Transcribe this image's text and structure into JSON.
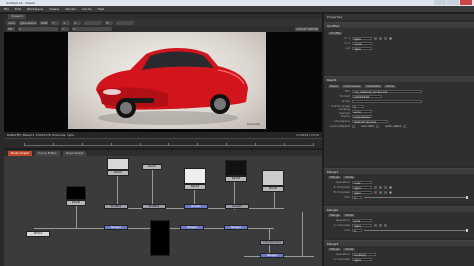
{
  "window": {
    "title": "Untitled.nk - NukeX"
  },
  "menubar": {
    "items": [
      "File",
      "Edit",
      "Workspace",
      "Viewer",
      "Render",
      "Cache",
      "Help"
    ]
  },
  "viewer": {
    "tabs": [
      "Viewer1"
    ],
    "controls_row1": [
      "rgba",
      "rgba.alpha",
      "RGB",
      "Y",
      "1",
      "A",
      "-",
      "B",
      "-"
    ],
    "controls_row2": [
      "f/8",
      "1",
      "Y",
      "1",
      "default (sRGB)"
    ],
    "photo_caption": "(picture)",
    "status_left": "RGBA(FP) 3Read:1 1024x576 channels: rgba",
    "status_right": "x=1024 y=576"
  },
  "nodegraph": {
    "tabs": [
      "Node Graph",
      "Curve Editor",
      "Dope Sheet"
    ],
    "active_tab": "Node Graph",
    "nodes": {
      "read1": "Read1",
      "read2": "Read2",
      "read3": "Read3",
      "read4": "Read4",
      "read5": "Read5",
      "read6": "Read6",
      "merge1": "Merge1",
      "merge2": "Merge2",
      "merge3": "Merge3",
      "merge4": "Merge4",
      "shuffle1": "Shuffle1",
      "shuffle2": "Shuffle2",
      "grade1": "Grade1",
      "grade2": "Grade2",
      "write1": "Write1",
      "dot": "ColorCorrect1"
    }
  },
  "properties": {
    "header": "Properties",
    "panels": [
      {
        "name": "Shuffle1",
        "tab": "Shuffle",
        "rows": [
          {
            "label": "in 1",
            "value": "rgba"
          },
          {
            "label": "in 2",
            "value": "none"
          },
          {
            "label": "out",
            "value": "rgba"
          }
        ]
      },
      {
        "name": "Read1",
        "tabs": [
          "Read",
          "Colorspace",
          "Metadata",
          "Node"
        ],
        "rows": [
          {
            "label": "file",
            "value": "car_default_render.exr"
          },
          {
            "label": "format",
            "value": "1024x576"
          },
          {
            "label": "proxy",
            "value": ""
          },
          {
            "label": "frame range",
            "value": "1"
          },
          {
            "label": "missing frames",
            "value": "error"
          },
          {
            "label": "frame",
            "value": "expression"
          },
          {
            "label": "colorspace",
            "value": "default (linear)"
          },
          {
            "label": "premultiplied",
            "value": ""
          },
          {
            "label": "raw data",
            "value": ""
          },
          {
            "label": "auto alpha",
            "value": ""
          }
        ]
      },
      {
        "name": "Merge1",
        "tabs": [
          "Merge",
          "Node"
        ],
        "rows": [
          {
            "label": "operation",
            "value": "over"
          },
          {
            "label": "A channels",
            "value": "rgba"
          },
          {
            "label": "B channels",
            "value": "rgba"
          },
          {
            "label": "output",
            "value": "rgba"
          },
          {
            "label": "also merge",
            "value": "none"
          },
          {
            "label": "mask",
            "value": "none"
          },
          {
            "label": "mix",
            "value": "1"
          }
        ]
      },
      {
        "name": "Merge2",
        "tabs": [
          "Merge",
          "Node"
        ],
        "rows": [
          {
            "label": "operation",
            "value": "plus"
          },
          {
            "label": "A channels",
            "value": "rgba"
          },
          {
            "label": "B channels",
            "value": "rgba"
          },
          {
            "label": "output",
            "value": "rgba"
          },
          {
            "label": "mix",
            "value": "1"
          }
        ]
      },
      {
        "name": "Merge3",
        "tabs": [
          "Merge",
          "Node"
        ],
        "rows": [
          {
            "label": "operation",
            "value": "multiply"
          },
          {
            "label": "A channels",
            "value": "rgba"
          },
          {
            "label": "output",
            "value": "rgba"
          }
        ]
      }
    ]
  },
  "colors": {
    "accent": "#c0492b",
    "node_blue": "#6d79c9",
    "car_red": "#d2141c"
  }
}
